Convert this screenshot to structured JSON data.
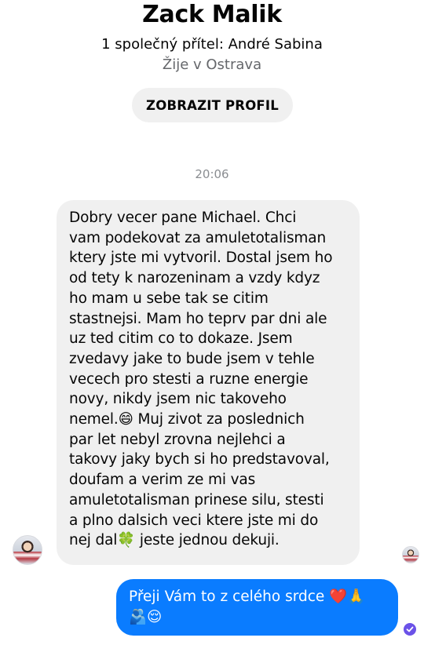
{
  "header": {
    "name": "Zack Malik",
    "mutual_friend": "1 společný přítel: André Sabina",
    "location": "Žije v Ostrava",
    "view_profile_label": "ZOBRAZIT PROFIL"
  },
  "thread": {
    "timestamp": "20:06",
    "messages": [
      {
        "direction": "incoming",
        "text": "Dobry vecer pane Michael. Chci\nvam podekovat za amuletotalisman\nktery jste mi vytvoril. Dostal jsem ho\nod tety k narozeninam a vzdy kdyz\nho mam u sebe tak se citim\nstastnejsi. Mam ho teprv par dni ale\nuz ted citim co to dokaze. Jsem\nzvedavy jake to bude jsem v tehle\nvecech pro stesti a ruzne energie\nnovy, nikdy jsem nic takoveho\nnemel.😄 Muj zivot za poslednich\npar let nebyl zrovna nejlehci a\ntakovy jaky bych si ho predstavoval,\ndoufam a verim ze mi vas\namuletotalisman prinese silu, stesti\na plno dalsich veci ktere jste mi do\nnej dal🍀 jeste jednou dekuji."
      },
      {
        "direction": "outgoing",
        "text": "Přeji Vám to z celého srdce ❤️🙏\n🫂😌"
      }
    ]
  },
  "icons": {
    "contact_avatar": "contact-avatar",
    "seen_avatar": "seen-avatar",
    "delivered": "check-circle-icon"
  },
  "colors": {
    "outgoing_bubble": "#0a7cff",
    "incoming_bubble": "#f0f0f0",
    "delivered_badge": "#6b52e8"
  }
}
